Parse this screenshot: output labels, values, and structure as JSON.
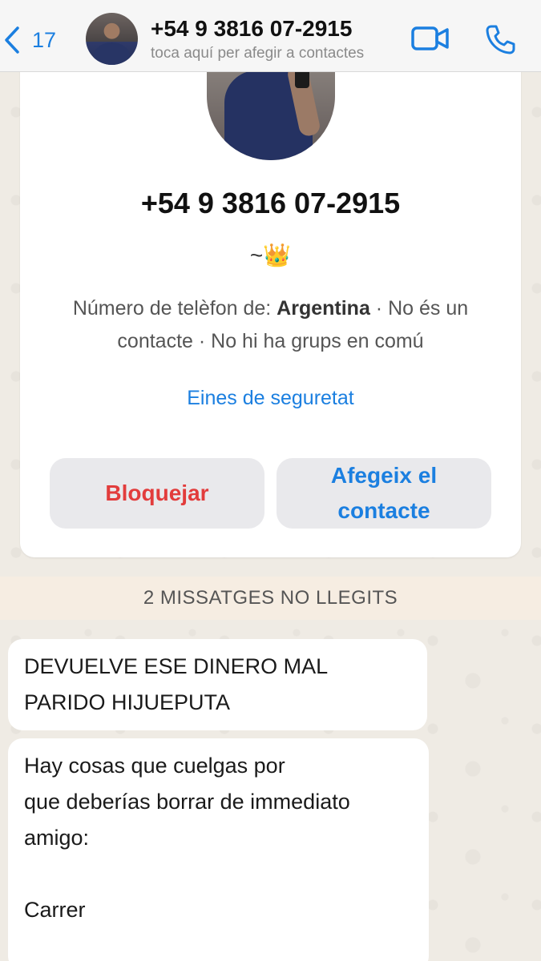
{
  "header": {
    "back_count": "17",
    "title": "+54 9 3816 07-2915",
    "subtitle": "toca aquí per afegir a contactes"
  },
  "card": {
    "number": "+54 9 3816 07-2915",
    "status": "~👑",
    "info_prefix": "Número de telèfon de: ",
    "info_country": "Argentina",
    "info_rest": " · No és un contacte · No hi ha grups en comú",
    "safety_link": "Eines de seguretat",
    "block_button": "Bloquejar",
    "add_button": "Afegeix el contacte"
  },
  "unread_divider": "2 MISSATGES NO LLEGITS",
  "messages": [
    {
      "lines": [
        "DEVUELVE ESE DINERO MAL",
        "PARIDO HIJUEPUTA"
      ]
    },
    {
      "lines": [
        "Hay cosas que cuelgas por",
        "que deberías borrar de immediato",
        "amigo:",
        "",
        "Carrer"
      ]
    }
  ],
  "colors": {
    "accent": "#1b7fe0",
    "danger": "#e23c3c",
    "divider_bg": "#f6ede2"
  }
}
